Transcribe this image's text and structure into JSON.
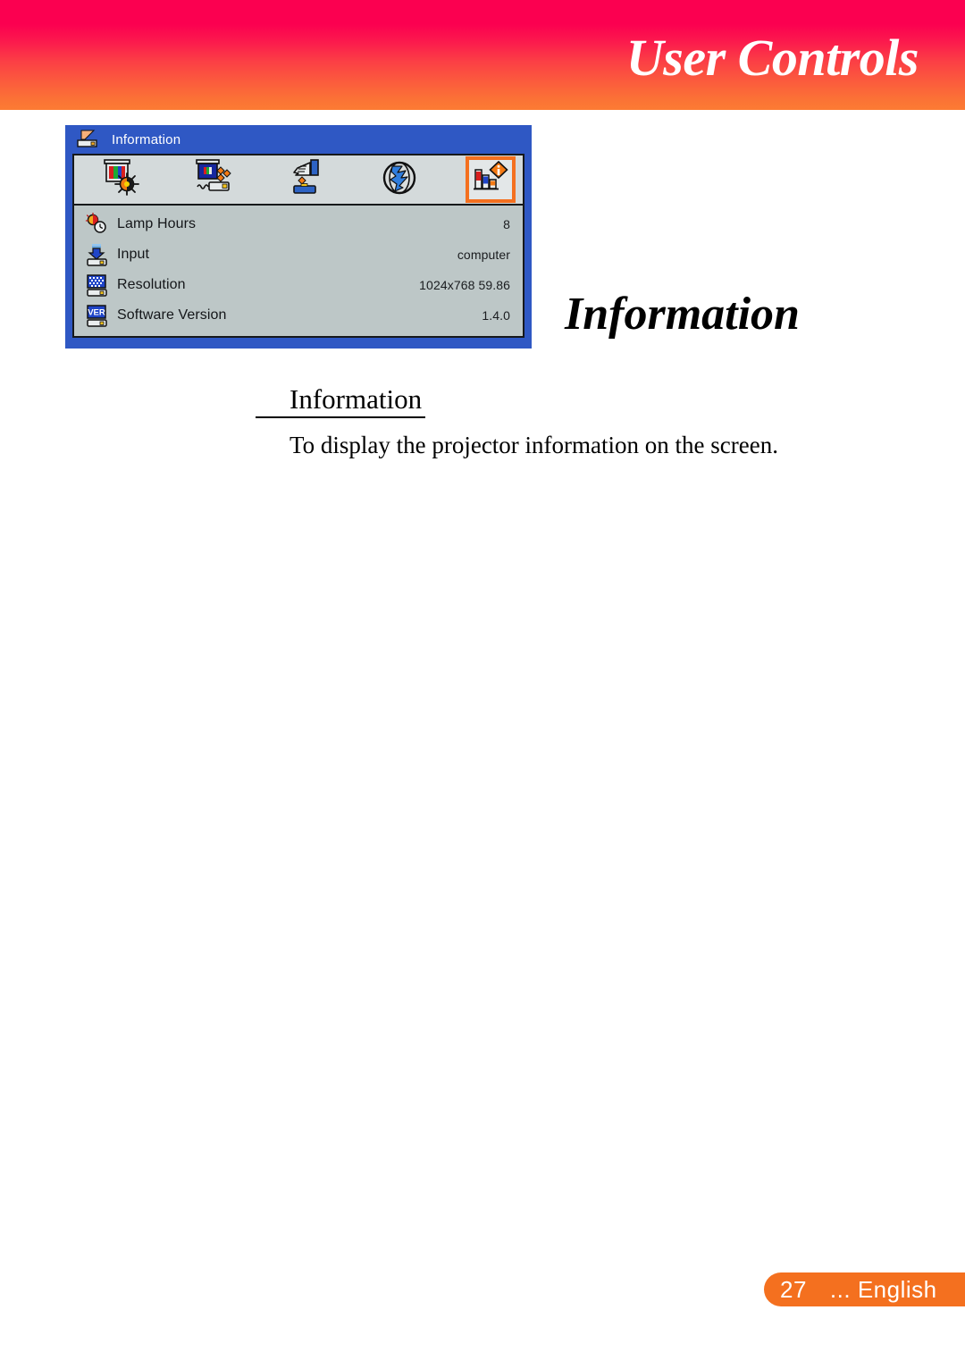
{
  "header": {
    "title": "User Controls",
    "gradient_top": "#FB0050",
    "gradient_bottom": "#FC7B33"
  },
  "osd": {
    "titlebar": {
      "icon": "projector-icon",
      "title": "Information",
      "frame_color": "#2F58C4"
    },
    "menu_icons": [
      {
        "name": "image-settings-icon",
        "label": "Image",
        "selected": false
      },
      {
        "name": "display-settings-icon",
        "label": "Display",
        "selected": false
      },
      {
        "name": "setup-hand-icon",
        "label": "Setup",
        "selected": false
      },
      {
        "name": "globe-language-icon",
        "label": "Language",
        "selected": false
      },
      {
        "name": "information-icon",
        "label": "Information",
        "selected": true
      }
    ],
    "selected_accent": "#F4701F",
    "rows": [
      {
        "icon": "lamp-hours-icon",
        "label": "Lamp Hours",
        "value": "8"
      },
      {
        "icon": "input-source-icon",
        "label": "Input",
        "value": "computer"
      },
      {
        "icon": "resolution-icon",
        "label": "Resolution",
        "value": "1024x768  59.86"
      },
      {
        "icon": "software-version-icon",
        "label": "Software Version",
        "value": "1.4.0"
      }
    ]
  },
  "section": {
    "title": "Information"
  },
  "content": {
    "subhead": "Information",
    "body": "To display the projector information on the screen."
  },
  "footer": {
    "page_number": "27",
    "language": "... English",
    "pill_color": "#F4701F"
  }
}
